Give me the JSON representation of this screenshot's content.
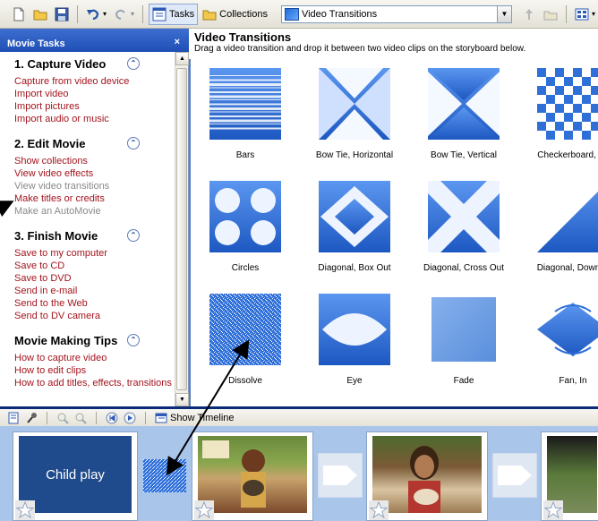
{
  "toolbar": {
    "tasks_label": "Tasks",
    "collections_label": "Collections",
    "collection_selected": "Video Transitions"
  },
  "taskpane": {
    "header": "Movie Tasks",
    "close": "×",
    "sections": [
      {
        "title": "1. Capture Video",
        "toggle": "⌃",
        "links": [
          {
            "label": "Capture from video device",
            "disabled": false
          },
          {
            "label": "Import video",
            "disabled": false
          },
          {
            "label": "Import pictures",
            "disabled": false
          },
          {
            "label": "Import audio or music",
            "disabled": false
          }
        ]
      },
      {
        "title": "2. Edit Movie",
        "toggle": "⌃",
        "links": [
          {
            "label": "Show collections",
            "disabled": false
          },
          {
            "label": "View video effects",
            "disabled": false
          },
          {
            "label": "View video transitions",
            "disabled": true
          },
          {
            "label": "Make titles or credits",
            "disabled": false
          },
          {
            "label": "Make an AutoMovie",
            "disabled": true
          }
        ]
      },
      {
        "title": "3. Finish Movie",
        "toggle": "⌃",
        "links": [
          {
            "label": "Save to my computer",
            "disabled": false
          },
          {
            "label": "Save to CD",
            "disabled": false
          },
          {
            "label": "Save to DVD",
            "disabled": false
          },
          {
            "label": "Send in e-mail",
            "disabled": false
          },
          {
            "label": "Send to the Web",
            "disabled": false
          },
          {
            "label": "Send to DV camera",
            "disabled": false
          }
        ]
      },
      {
        "title": "Movie Making Tips",
        "toggle": "⌃",
        "links": [
          {
            "label": "How to capture video",
            "disabled": false
          },
          {
            "label": "How to edit clips",
            "disabled": false
          },
          {
            "label": "How to add titles, effects, transitions",
            "disabled": false
          }
        ]
      }
    ]
  },
  "main": {
    "title": "Video Transitions",
    "subtitle": "Drag a video transition and drop it between two video clips on the storyboard below.",
    "transitions": [
      {
        "label": "Bars",
        "icon": "bars-transition-icon"
      },
      {
        "label": "Bow Tie, Horizontal",
        "icon": "bow-tie-horizontal-icon"
      },
      {
        "label": "Bow Tie, Vertical",
        "icon": "bow-tie-vertical-icon"
      },
      {
        "label": "Checkerboard, Ac",
        "icon": "checkerboard-icon"
      },
      {
        "label": "Circles",
        "icon": "circles-icon"
      },
      {
        "label": "Diagonal, Box Out",
        "icon": "diagonal-box-out-icon"
      },
      {
        "label": "Diagonal, Cross Out",
        "icon": "diagonal-cross-out-icon"
      },
      {
        "label": "Diagonal, Down R",
        "icon": "diagonal-down-right-icon"
      },
      {
        "label": "Dissolve",
        "icon": "dissolve-icon"
      },
      {
        "label": "Eye",
        "icon": "eye-icon"
      },
      {
        "label": "Fade",
        "icon": "fade-icon"
      },
      {
        "label": "Fan, In",
        "icon": "fan-in-icon"
      }
    ]
  },
  "timeline_bar": {
    "show_timeline_label": "Show Timeline"
  },
  "storyboard": {
    "title_clip_text": "Child play"
  },
  "colors": {
    "accent_blue": "#2f6fd8",
    "link_red": "#a3141e",
    "storyboard_bg": "#a9c5ea",
    "title_clip_bg": "#1f4a8c"
  }
}
